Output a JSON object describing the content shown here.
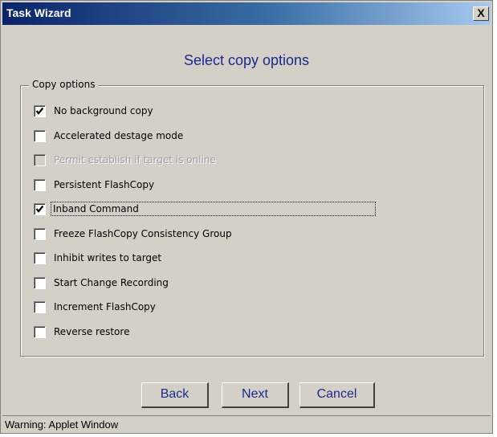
{
  "window": {
    "title": "Task Wizard",
    "close_glyph": "X"
  },
  "page": {
    "heading": "Select copy options"
  },
  "group": {
    "label": "Copy options"
  },
  "options": [
    {
      "label": "No background copy",
      "checked": true,
      "enabled": true
    },
    {
      "label": "Accelerated destage mode",
      "checked": false,
      "enabled": true
    },
    {
      "label": "Permit establish if target is online",
      "checked": false,
      "enabled": false
    },
    {
      "label": "Persistent FlashCopy",
      "checked": false,
      "enabled": true
    },
    {
      "label": "Inband Command",
      "checked": true,
      "enabled": true,
      "focused": true
    },
    {
      "label": "Freeze FlashCopy Consistency Group",
      "checked": false,
      "enabled": true
    },
    {
      "label": "Inhibit writes to target",
      "checked": false,
      "enabled": true
    },
    {
      "label": "Start Change Recording",
      "checked": false,
      "enabled": true
    },
    {
      "label": "Increment FlashCopy",
      "checked": false,
      "enabled": true
    },
    {
      "label": "Reverse restore",
      "checked": false,
      "enabled": true
    }
  ],
  "buttons": {
    "back": "Back",
    "next": "Next",
    "cancel": "Cancel"
  },
  "status": {
    "text": "Warning: Applet Window"
  },
  "colors": {
    "title_gradient_start": "#0a246a",
    "title_gradient_end": "#a6caf0",
    "dialog_bg": "#d4d0c8",
    "heading_text": "#1a2a8c",
    "disabled_text": "#a0a0a0"
  }
}
